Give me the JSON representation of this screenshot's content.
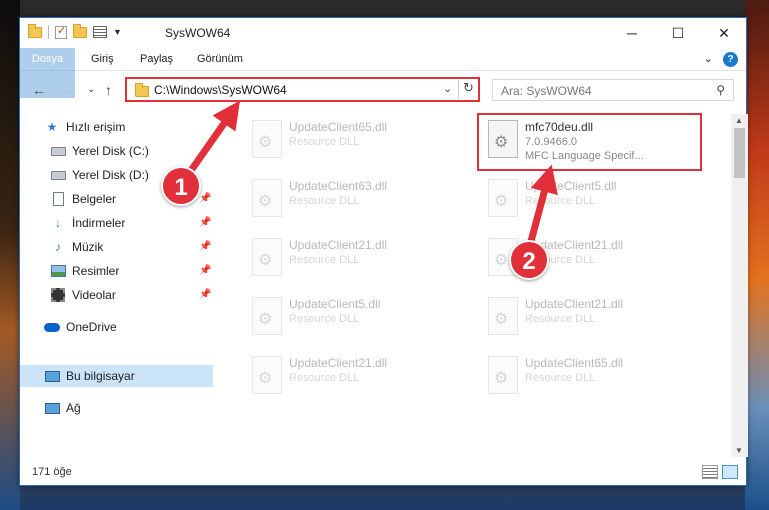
{
  "window": {
    "title": "SysWOW64",
    "min_glyph": "─",
    "max_glyph": "☐",
    "close_glyph": "✕"
  },
  "ribbon": {
    "tabs": [
      "Dosya",
      "Giriş",
      "Paylaş",
      "Görünüm"
    ],
    "expand_glyph": "⌄",
    "help_glyph": "?"
  },
  "nav": {
    "back_glyph": "←",
    "forward_glyph": "→",
    "recent_glyph": "⌄",
    "up_glyph": "↑",
    "address": "C:\\Windows\\SysWOW64",
    "address_dd_glyph": "⌄",
    "refresh_glyph": "↻",
    "search_placeholder": "Ara: SysWOW64",
    "search_glyph": "⚲"
  },
  "sidebar": {
    "items": [
      {
        "label": "Hızlı erişim",
        "icon": "star-icon"
      },
      {
        "label": "Yerel Disk (C:)",
        "icon": "drive-icon"
      },
      {
        "label": "Yerel Disk (D:)",
        "icon": "drive-icon"
      },
      {
        "label": "Belgeler",
        "icon": "documents-icon",
        "pinned": true
      },
      {
        "label": "İndirmeler",
        "icon": "download-icon",
        "pinned": true
      },
      {
        "label": "Müzik",
        "icon": "music-icon",
        "pinned": true
      },
      {
        "label": "Resimler",
        "icon": "pictures-icon",
        "pinned": true
      },
      {
        "label": "Videolar",
        "icon": "videos-icon",
        "pinned": true
      },
      {
        "label": "OneDrive",
        "icon": "cloud-icon"
      },
      {
        "label": "Bu bilgisayar",
        "icon": "computer-icon",
        "selected": true
      },
      {
        "label": "Ağ",
        "icon": "network-icon"
      }
    ],
    "pin_glyph": "📌"
  },
  "files": [
    {
      "name": "UpdateClient65.dll",
      "line1": "Resource DLL",
      "line2": ""
    },
    {
      "name": "mfc70deu.dll",
      "line1": "7.0.9466.0",
      "line2": "MFC Language Specif...",
      "active": true
    },
    {
      "name": "UpdateClient63.dll",
      "line1": "Resource DLL",
      "line2": ""
    },
    {
      "name": "UpdateClient5.dll",
      "line1": "Resource DLL",
      "line2": ""
    },
    {
      "name": "UpdateClient21.dll",
      "line1": "Resource DLL",
      "line2": ""
    },
    {
      "name": "UpdateClient21.dll",
      "line1": "Resource DLL",
      "line2": ""
    },
    {
      "name": "UpdateClient5.dll",
      "line1": "Resource DLL",
      "line2": ""
    },
    {
      "name": "UpdateClient21.dll",
      "line1": "Resource DLL",
      "line2": ""
    },
    {
      "name": "UpdateClient21.dll",
      "line1": "Resource DLL",
      "line2": ""
    },
    {
      "name": "UpdateClient65.dll",
      "line1": "Resource DLL",
      "line2": ""
    }
  ],
  "status": {
    "count": "171 öğe"
  },
  "annotations": {
    "step1": "1",
    "step2": "2",
    "color": "#e2303a"
  }
}
